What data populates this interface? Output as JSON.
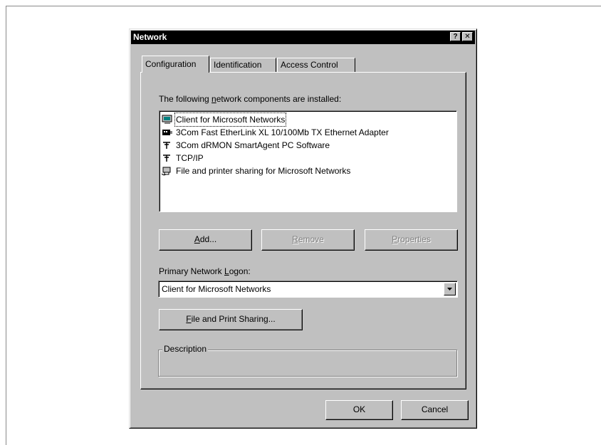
{
  "window": {
    "title": "Network",
    "help_glyph": "?",
    "close_glyph": "✕"
  },
  "tabs": [
    {
      "label": "Configuration",
      "active": true
    },
    {
      "label": "Identification",
      "active": false
    },
    {
      "label": "Access Control",
      "active": false
    }
  ],
  "components": {
    "label_pre": "The following ",
    "label_ul": "n",
    "label_post": "etwork components are installed:",
    "items": [
      {
        "label": "Client for Microsoft Networks",
        "icon": "client-icon",
        "selected": true
      },
      {
        "label": "3Com Fast EtherLink XL 10/100Mb TX Ethernet Adapter",
        "icon": "network-adapter-icon",
        "selected": false
      },
      {
        "label": "3Com dRMON SmartAgent PC Software",
        "icon": "protocol-icon",
        "selected": false
      },
      {
        "label": "TCP/IP",
        "icon": "protocol-icon",
        "selected": false
      },
      {
        "label": "File and printer sharing for Microsoft Networks",
        "icon": "service-icon",
        "selected": false
      }
    ]
  },
  "buttons": {
    "add": {
      "ul": "A",
      "rest": "dd...",
      "enabled": true
    },
    "remove": {
      "ul": "R",
      "rest": "emove",
      "enabled": false
    },
    "properties": {
      "ul": "P",
      "rest": "roperties",
      "enabled": false
    },
    "file_print_sharing": {
      "ul": "F",
      "rest": "ile and Print Sharing...",
      "enabled": true
    },
    "ok": "OK",
    "cancel": "Cancel"
  },
  "logon": {
    "label_pre": "Primary Network ",
    "label_ul": "L",
    "label_post": "ogon:",
    "selected_value": "Client for Microsoft Networks"
  },
  "description": {
    "label": "Description",
    "text": ""
  },
  "colors": {
    "face": "#c0c0c0",
    "titlebar": "#000000",
    "disabled_text": "#808080"
  }
}
